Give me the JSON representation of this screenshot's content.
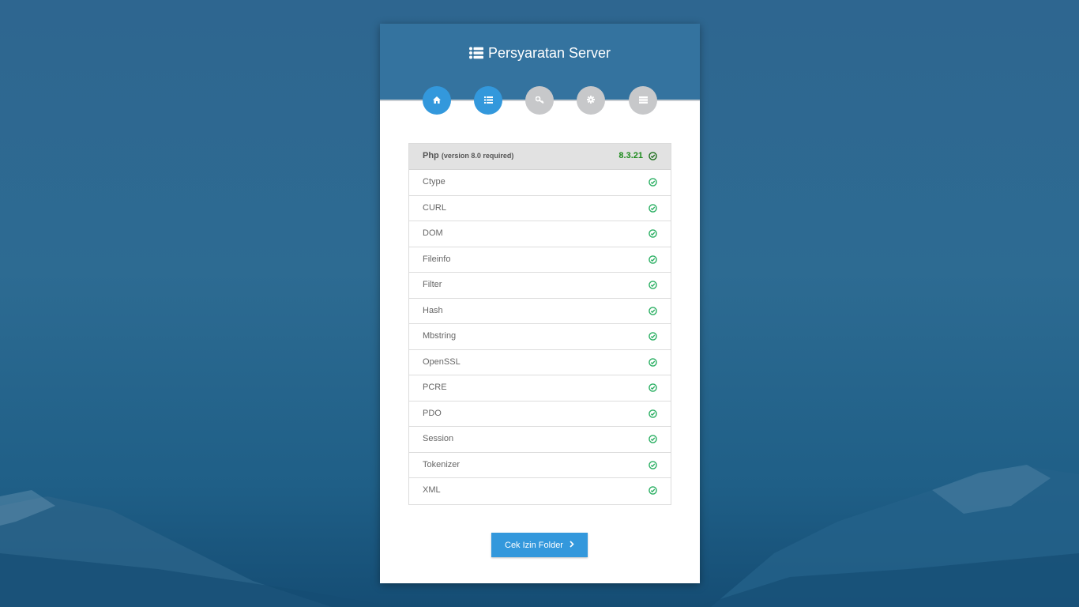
{
  "header": {
    "title": "Persyaratan Server",
    "title_icon": "list-icon"
  },
  "steps": [
    {
      "icon": "home-icon",
      "state": "active"
    },
    {
      "icon": "list-icon",
      "state": "active"
    },
    {
      "icon": "key-icon",
      "state": "inactive"
    },
    {
      "icon": "gear-icon",
      "state": "inactive"
    },
    {
      "icon": "server-icon",
      "state": "inactive"
    }
  ],
  "requirements": {
    "php": {
      "name": "Php",
      "note": "(version 8.0 required)",
      "version": "8.3.21",
      "status": "ok"
    },
    "extensions": [
      {
        "name": "Ctype",
        "status": "ok"
      },
      {
        "name": "CURL",
        "status": "ok"
      },
      {
        "name": "DOM",
        "status": "ok"
      },
      {
        "name": "Fileinfo",
        "status": "ok"
      },
      {
        "name": "Filter",
        "status": "ok"
      },
      {
        "name": "Hash",
        "status": "ok"
      },
      {
        "name": "Mbstring",
        "status": "ok"
      },
      {
        "name": "OpenSSL",
        "status": "ok"
      },
      {
        "name": "PCRE",
        "status": "ok"
      },
      {
        "name": "PDO",
        "status": "ok"
      },
      {
        "name": "Session",
        "status": "ok"
      },
      {
        "name": "Tokenizer",
        "status": "ok"
      },
      {
        "name": "XML",
        "status": "ok"
      }
    ]
  },
  "actions": {
    "next_label": "Cek Izin Folder"
  },
  "colors": {
    "header_bg": "#34739f",
    "step_active": "#3398dc",
    "step_inactive": "#c7c8ca",
    "ok_green": "#27ae60",
    "version_green": "#1b8a1b",
    "button_bg": "#3398dc"
  }
}
